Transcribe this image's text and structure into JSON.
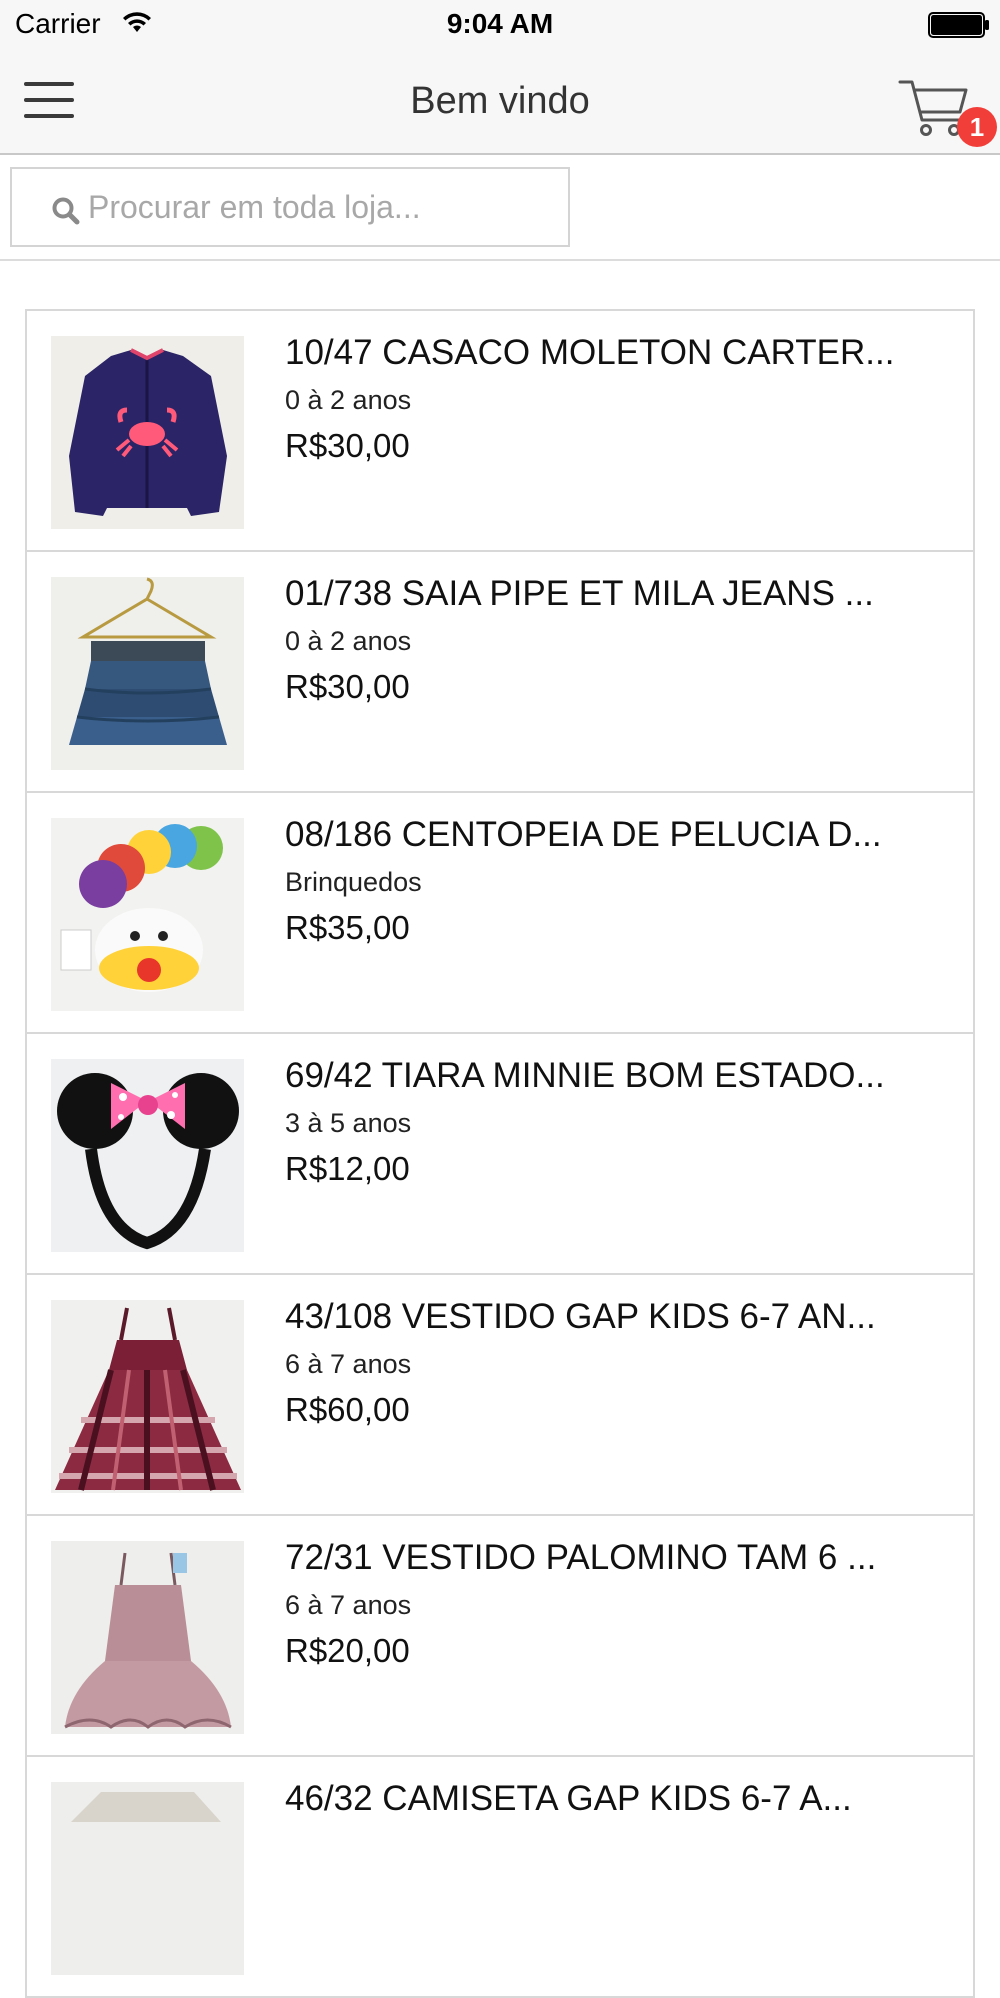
{
  "status_bar": {
    "carrier": "Carrier",
    "time": "9:04 AM"
  },
  "nav": {
    "title": "Bem vindo",
    "cart_count": "1",
    "menu_icon": "hamburger-menu-icon",
    "cart_icon": "shopping-cart-icon"
  },
  "search": {
    "placeholder": "Procurar em toda loja...",
    "value": ""
  },
  "colors": {
    "badge": "#f23e39",
    "nav_background": "#f7f7f7"
  },
  "products": [
    {
      "name": "10/47 CASACO MOLETON CARTER...",
      "category": "0 à 2 anos",
      "price": "R$30,00",
      "image": "navy-crab-jacket"
    },
    {
      "name": "01/738 SAIA PIPE ET MILA JEANS ...",
      "category": "0 à 2 anos",
      "price": "R$30,00",
      "image": "denim-ruffle-skirt"
    },
    {
      "name": "08/186 CENTOPEIA DE PELUCIA D...",
      "category": "Brinquedos",
      "price": "R$35,00",
      "image": "plush-caterpillar"
    },
    {
      "name": "69/42 TIARA MINNIE BOM ESTADO...",
      "category": "3 à 5 anos",
      "price": "R$12,00",
      "image": "minnie-headband"
    },
    {
      "name": "43/108 VESTIDO GAP KIDS 6-7 AN...",
      "category": "6 à 7 anos",
      "price": "R$60,00",
      "image": "plaid-dress"
    },
    {
      "name": "72/31 VESTIDO PALOMINO TAM 6 ...",
      "category": "6 à 7 anos",
      "price": "R$20,00",
      "image": "floral-dress"
    },
    {
      "name": "46/32 CAMISETA GAP KIDS 6-7 A...",
      "category": "",
      "price": "",
      "image": "tshirt"
    }
  ]
}
